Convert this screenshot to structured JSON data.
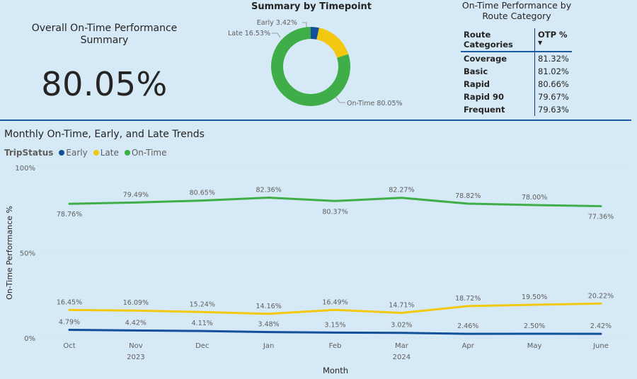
{
  "kpi": {
    "title": "Overall On-Time Performance Summary",
    "value": "80.05%"
  },
  "donut": {
    "title": "Summary by Timepoint",
    "slices": [
      {
        "label": "Early",
        "value": 3.42,
        "display": "Early 3.42%",
        "color": "#12519a"
      },
      {
        "label": "Late",
        "value": 16.53,
        "display": "Late 16.53%",
        "color": "#f2c811"
      },
      {
        "label": "On-Time",
        "value": 80.05,
        "display": "On-Time 80.05%",
        "color": "#3fae49"
      }
    ]
  },
  "route_table": {
    "title": "On-Time Performance by Route Category",
    "col_category": "Route Categories",
    "col_otp": "OTP %",
    "sort_indicator": "▼",
    "rows": [
      {
        "category": "Coverage",
        "otp": "81.32%"
      },
      {
        "category": "Basic",
        "otp": "81.02%"
      },
      {
        "category": "Rapid",
        "otp": "80.66%"
      },
      {
        "category": "Rapid 90",
        "otp": "79.67%"
      },
      {
        "category": "Frequent",
        "otp": "79.63%"
      }
    ]
  },
  "trend": {
    "title": "Monthly On-Time, Early, and Late Trends",
    "legend_title": "TripStatus"
  },
  "chart_data": {
    "type": "line",
    "title": "Monthly On-Time, Early, and Late Trends",
    "xlabel": "Month",
    "ylabel": "On-Time Performance %",
    "categories": [
      "Oct",
      "Nov",
      "Dec",
      "Jan",
      "Feb",
      "Mar",
      "Apr",
      "May",
      "June"
    ],
    "year_labels": [
      {
        "label": "2023",
        "under": "Nov"
      },
      {
        "label": "2024",
        "under": "Mar"
      }
    ],
    "ylim": [
      0,
      100
    ],
    "yticks": [
      "0%",
      "50%",
      "100%"
    ],
    "grid": true,
    "legend_position": "top-left",
    "series": [
      {
        "name": "Early",
        "color": "#12519a",
        "values": [
          4.79,
          4.42,
          4.11,
          3.48,
          3.15,
          3.02,
          2.46,
          2.5,
          2.42
        ],
        "labels": [
          "4.79%",
          "4.42%",
          "4.11%",
          "3.48%",
          "3.15%",
          "3.02%",
          "2.46%",
          "2.50%",
          "2.42%"
        ]
      },
      {
        "name": "Late",
        "color": "#f2c811",
        "values": [
          16.45,
          16.09,
          15.24,
          14.16,
          16.49,
          14.71,
          18.72,
          19.5,
          20.22
        ],
        "labels": [
          "16.45%",
          "16.09%",
          "15.24%",
          "14.16%",
          "16.49%",
          "14.71%",
          "18.72%",
          "19.50%",
          "20.22%"
        ]
      },
      {
        "name": "On-Time",
        "color": "#3fae49",
        "values": [
          78.76,
          79.49,
          80.65,
          82.36,
          80.37,
          82.27,
          78.82,
          78.0,
          77.36
        ],
        "labels": [
          "78.76%",
          "79.49%",
          "80.65%",
          "82.36%",
          "80.37%",
          "82.27%",
          "78.82%",
          "78.00%",
          "77.36%"
        ]
      }
    ]
  }
}
